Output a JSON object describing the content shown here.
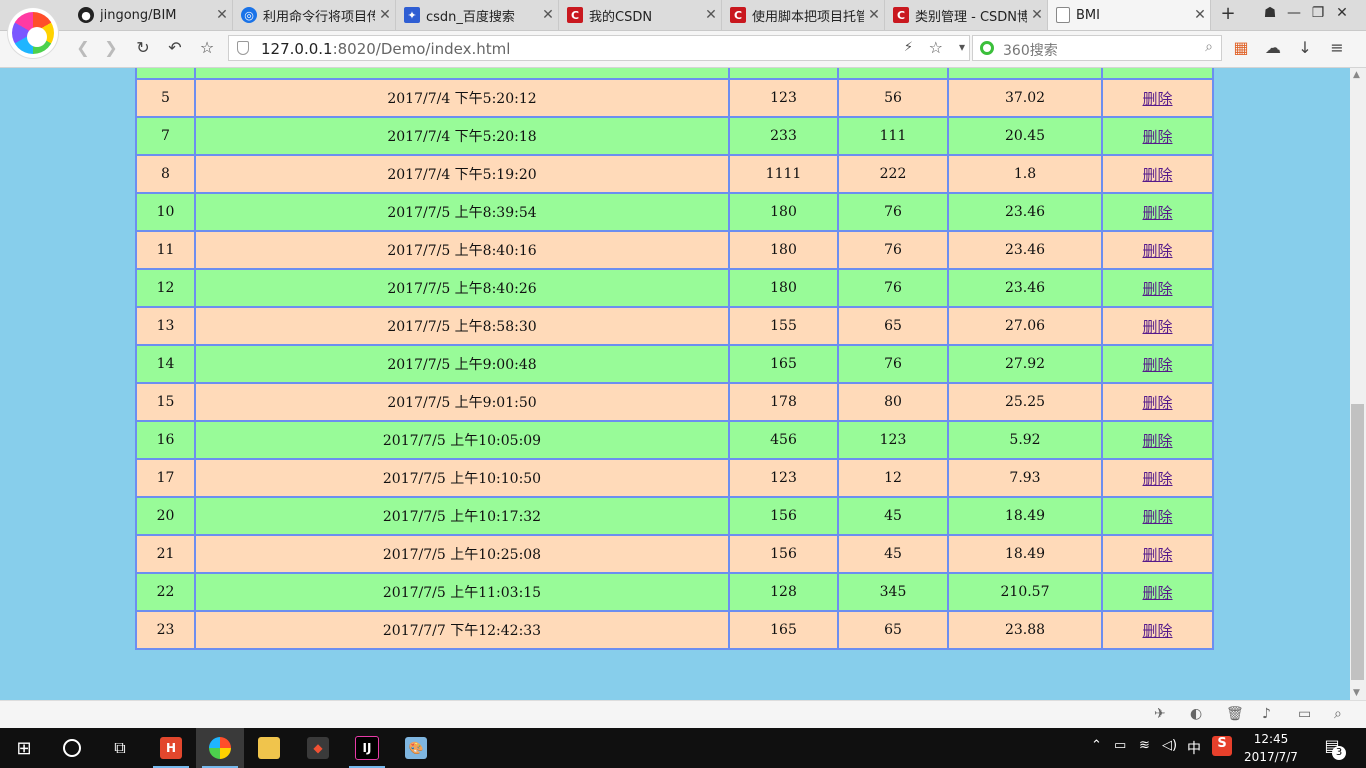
{
  "browser": {
    "tabs": [
      {
        "label": "jingong/BIM",
        "icon": "github-icon"
      },
      {
        "label": "利用命令行将项目传",
        "icon": "globe-icon"
      },
      {
        "label": "csdn_百度搜索",
        "icon": "baidu-paw-icon"
      },
      {
        "label": "我的CSDN",
        "icon": "csdn-icon"
      },
      {
        "label": "使用脚本把项目托管",
        "icon": "csdn-icon"
      },
      {
        "label": "类别管理 - CSDN博",
        "icon": "csdn-icon"
      },
      {
        "label": "BMI",
        "icon": "document-icon"
      }
    ],
    "address": {
      "host": "127.0.0.1",
      "rest": ":8020/Demo/index.html"
    },
    "search_placeholder": "360搜索"
  },
  "table": {
    "delete_label": "删除",
    "rows": [
      {
        "id": "",
        "time": "",
        "height": "",
        "weight": "",
        "bmi": ""
      },
      {
        "id": "5",
        "time": "2017/7/4 下午5:20:12",
        "height": "123",
        "weight": "56",
        "bmi": "37.02"
      },
      {
        "id": "7",
        "time": "2017/7/4 下午5:20:18",
        "height": "233",
        "weight": "111",
        "bmi": "20.45"
      },
      {
        "id": "8",
        "time": "2017/7/4 下午5:19:20",
        "height": "1111",
        "weight": "222",
        "bmi": "1.8"
      },
      {
        "id": "10",
        "time": "2017/7/5 上午8:39:54",
        "height": "180",
        "weight": "76",
        "bmi": "23.46"
      },
      {
        "id": "11",
        "time": "2017/7/5 上午8:40:16",
        "height": "180",
        "weight": "76",
        "bmi": "23.46"
      },
      {
        "id": "12",
        "time": "2017/7/5 上午8:40:26",
        "height": "180",
        "weight": "76",
        "bmi": "23.46"
      },
      {
        "id": "13",
        "time": "2017/7/5 上午8:58:30",
        "height": "155",
        "weight": "65",
        "bmi": "27.06"
      },
      {
        "id": "14",
        "time": "2017/7/5 上午9:00:48",
        "height": "165",
        "weight": "76",
        "bmi": "27.92"
      },
      {
        "id": "15",
        "time": "2017/7/5 上午9:01:50",
        "height": "178",
        "weight": "80",
        "bmi": "25.25"
      },
      {
        "id": "16",
        "time": "2017/7/5 上午10:05:09",
        "height": "456",
        "weight": "123",
        "bmi": "5.92"
      },
      {
        "id": "17",
        "time": "2017/7/5 上午10:10:50",
        "height": "123",
        "weight": "12",
        "bmi": "7.93"
      },
      {
        "id": "20",
        "time": "2017/7/5 上午10:17:32",
        "height": "156",
        "weight": "45",
        "bmi": "18.49"
      },
      {
        "id": "21",
        "time": "2017/7/5 上午10:25:08",
        "height": "156",
        "weight": "45",
        "bmi": "18.49"
      },
      {
        "id": "22",
        "time": "2017/7/5 上午11:03:15",
        "height": "128",
        "weight": "345",
        "bmi": "210.57"
      },
      {
        "id": "23",
        "time": "2017/7/7 下午12:42:33",
        "height": "165",
        "weight": "65",
        "bmi": "23.88"
      }
    ]
  },
  "taskbar": {
    "apps": [
      "hbuilder-icon",
      "browser-360-icon",
      "file-explorer-icon",
      "git-icon",
      "intellij-icon",
      "paint-icon"
    ],
    "ime": "中",
    "time": "12:45",
    "date": "2017/7/7",
    "notifications": "3"
  },
  "colors": {
    "page_bg": "#87ceeb",
    "row_green": "#98fb98",
    "row_peach": "#ffdab9",
    "border": "#6c8ef0"
  }
}
